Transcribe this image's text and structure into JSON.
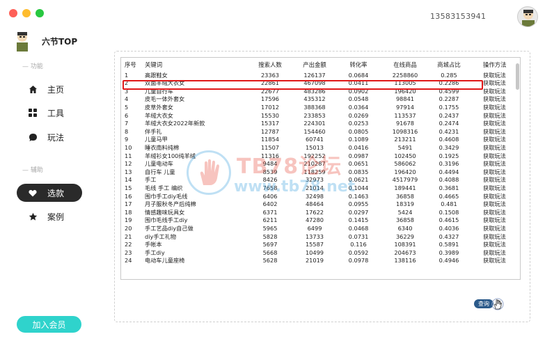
{
  "header": {
    "phone": "13583153941"
  },
  "brand": {
    "name": "六节TOP"
  },
  "sidebar": {
    "section_function": "功能",
    "section_assist": "辅助",
    "items": [
      {
        "label": "主页",
        "icon": "home-icon"
      },
      {
        "label": "工具",
        "icon": "grid-icon"
      },
      {
        "label": "玩法",
        "icon": "chat-bubble-icon"
      },
      {
        "label": "选款",
        "icon": "heart-icon",
        "active": true
      },
      {
        "label": "案例",
        "icon": "star-icon"
      }
    ],
    "vip_label": "加入会员"
  },
  "table": {
    "columns": [
      "序号",
      "关键词",
      "搜索人数",
      "产出金额",
      "转化率",
      "在线商品",
      "商城占比",
      "操作方法"
    ],
    "selected_row": 2,
    "rows": [
      [
        "1",
        "高跟鞋女",
        "23363",
        "126137",
        "0.0684",
        "2258860",
        "0.285",
        "获取玩法"
      ],
      [
        "2",
        "双面羊绒大衣女",
        "22861",
        "467098",
        "0.0411",
        "113005",
        "0.2286",
        "获取玩法"
      ],
      [
        "3",
        "儿童自行车",
        "22677",
        "483286",
        "0.0902",
        "196420",
        "0.4599",
        "获取玩法"
      ],
      [
        "4",
        "皮毛一体外套女",
        "17596",
        "435312",
        "0.0548",
        "98841",
        "0.2287",
        "获取玩法"
      ],
      [
        "5",
        "皮草外套女",
        "17012",
        "388368",
        "0.0364",
        "97914",
        "0.1755",
        "获取玩法"
      ],
      [
        "6",
        "羊绒大衣女",
        "15530",
        "233853",
        "0.0269",
        "113537",
        "0.2437",
        "获取玩法"
      ],
      [
        "7",
        "羊绒大衣女2022年新款",
        "15317",
        "224301",
        "0.0253",
        "91678",
        "0.2474",
        "获取玩法"
      ],
      [
        "8",
        "伴手礼",
        "12787",
        "154460",
        "0.0805",
        "1098316",
        "0.4231",
        "获取玩法"
      ],
      [
        "9",
        "儿童马甲",
        "11854",
        "60741",
        "0.1089",
        "213211",
        "0.4608",
        "获取玩法"
      ],
      [
        "10",
        "睡衣南料纯棉",
        "11507",
        "15013",
        "0.0416",
        "5491",
        "0.3429",
        "获取玩法"
      ],
      [
        "11",
        "羊绒衫女100纯羊绒",
        "11316",
        "192252",
        "0.0987",
        "102450",
        "0.1925",
        "获取玩法"
      ],
      [
        "12",
        "儿童电动车",
        "9484",
        "210287",
        "0.0651",
        "586062",
        "0.3196",
        "获取玩法"
      ],
      [
        "13",
        "自行车 儿童",
        "8539",
        "118259",
        "0.0835",
        "196420",
        "0.4494",
        "获取玩法"
      ],
      [
        "14",
        "手工",
        "8426",
        "32973",
        "0.0621",
        "4517979",
        "0.4088",
        "获取玩法"
      ],
      [
        "15",
        "毛线 手工 编织",
        "7658",
        "21014",
        "0.1044",
        "189441",
        "0.3681",
        "获取玩法"
      ],
      [
        "16",
        "围巾手工diy毛线",
        "6406",
        "32498",
        "0.1463",
        "36858",
        "0.4665",
        "获取玩法"
      ],
      [
        "17",
        "月子服秋冬产后纯棉",
        "6402",
        "48464",
        "0.0955",
        "18319",
        "0.481",
        "获取玩法"
      ],
      [
        "18",
        "情感趣味玩具女",
        "6371",
        "17622",
        "0.0297",
        "5424",
        "0.1508",
        "获取玩法"
      ],
      [
        "19",
        "围巾毛线手工diy",
        "6211",
        "47280",
        "0.1415",
        "36858",
        "0.4615",
        "获取玩法"
      ],
      [
        "20",
        "手工艺品diy自己做",
        "5965",
        "6499",
        "0.0468",
        "6340",
        "0.4036",
        "获取玩法"
      ],
      [
        "21",
        "diy手工礼物",
        "5828",
        "13733",
        "0.0731",
        "36229",
        "0.4327",
        "获取玩法"
      ],
      [
        "22",
        "手帐本",
        "5697",
        "15587",
        "0.116",
        "108391",
        "0.5891",
        "获取玩法"
      ],
      [
        "23",
        "手工diy",
        "5668",
        "10499",
        "0.0592",
        "204673",
        "0.3989",
        "获取玩法"
      ],
      [
        "24",
        "电动车儿童座椅",
        "5628",
        "21019",
        "0.0978",
        "138116",
        "0.4946",
        "获取玩法"
      ]
    ]
  },
  "query_label": "查询",
  "watermark": {
    "text": "TB78论坛",
    "url": "www.tb78.net"
  },
  "colors": {
    "accent": "#2fd3cc",
    "active_nav": "#2a2a2a",
    "highlight": "#e01818",
    "query": "#2b5a8a"
  }
}
